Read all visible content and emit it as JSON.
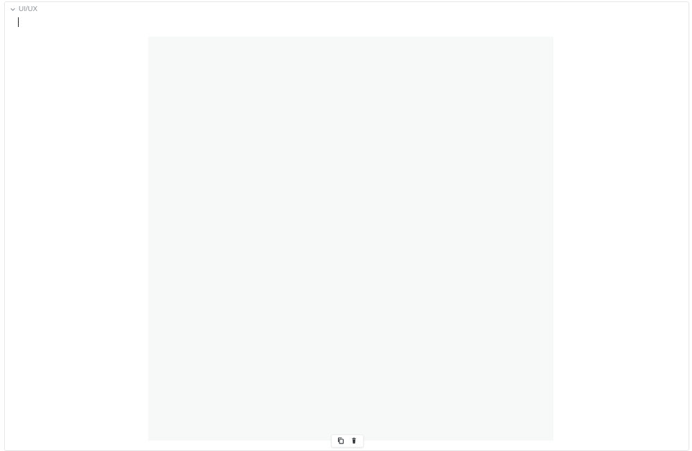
{
  "section": {
    "title": "UI/UX",
    "expanded": true,
    "chevron_icon": "chevron-down-icon"
  },
  "editor": {
    "text": "",
    "cursor_visible": true
  },
  "block": {
    "background": "#f7f8f8"
  },
  "toolbar": {
    "buttons": [
      {
        "name": "duplicate",
        "icon": "copy-icon"
      },
      {
        "name": "delete",
        "icon": "trash-icon"
      }
    ]
  },
  "colors": {
    "border": "#e4e6e8",
    "muted_text": "#8b9196",
    "icon": "#2b2f33"
  }
}
